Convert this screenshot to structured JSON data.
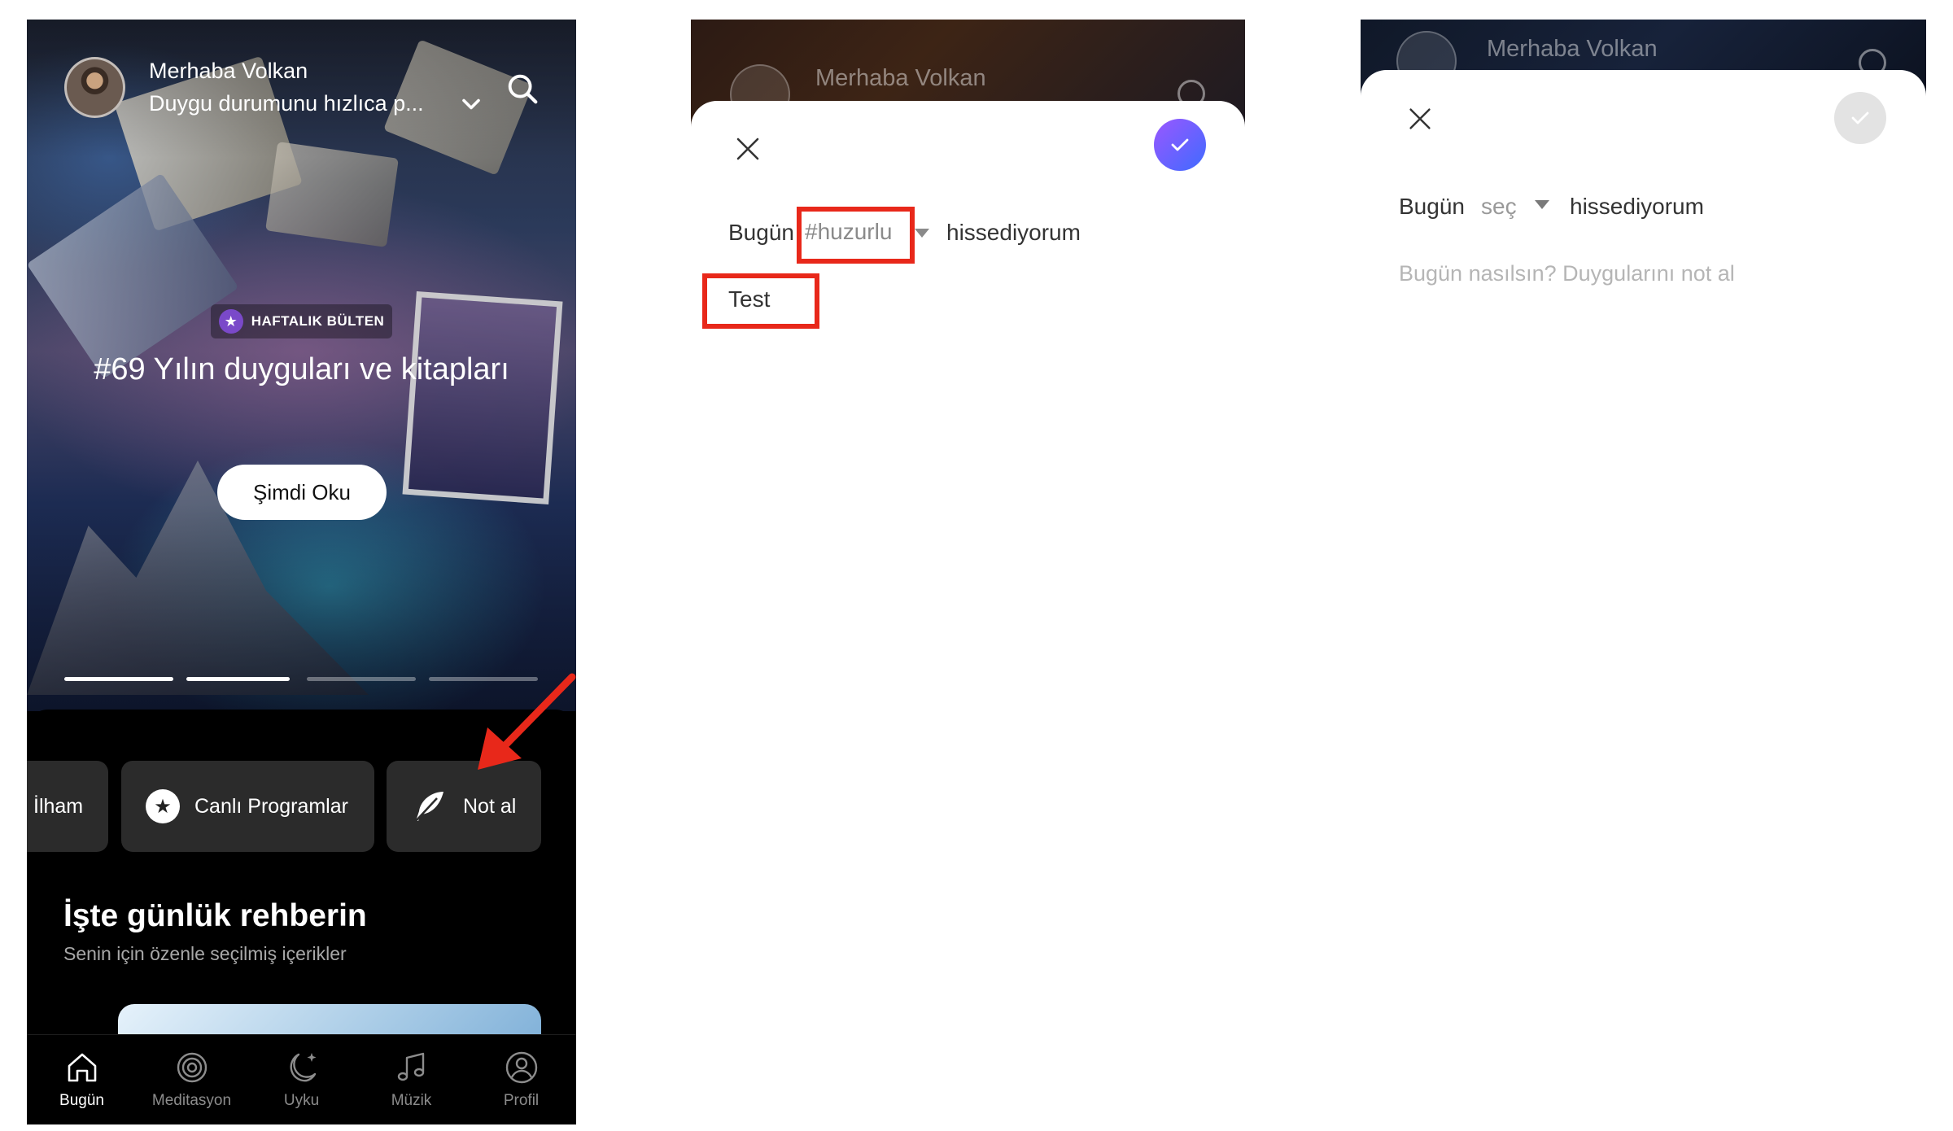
{
  "panel1": {
    "header": {
      "greeting": "Merhaba Volkan",
      "mood_prompt": "Duygu durumunu hızlıca p..."
    },
    "hero": {
      "badge": "HAFTALIK BÜLTEN",
      "title": "#69 Yılın duyguları ve kitapları",
      "cta": "Şimdi Oku",
      "carousel_pages": 4,
      "carousel_active_index": 1
    },
    "chips": [
      {
        "label": "İlham",
        "icon": "partial"
      },
      {
        "label": "Canlı Programlar",
        "icon": "star-badge-icon"
      },
      {
        "label": "Not al",
        "icon": "feather-icon"
      }
    ],
    "guide": {
      "title": "İşte günlük rehberin",
      "subtitle": "Senin için özenle seçilmiş içerikler"
    },
    "tabs": [
      {
        "label": "Bugün",
        "icon": "home-icon",
        "active": true
      },
      {
        "label": "Meditasyon",
        "icon": "target-icon",
        "active": false
      },
      {
        "label": "Uyku",
        "icon": "moon-icon",
        "active": false
      },
      {
        "label": "Müzik",
        "icon": "music-note-icon",
        "active": false
      },
      {
        "label": "Profil",
        "icon": "profile-icon",
        "active": false
      }
    ]
  },
  "panel2": {
    "background_greeting": "Merhaba Volkan",
    "prefix": "Bugün",
    "selected_tag": "#huzurlu",
    "suffix": "hissediyorum",
    "note_value": "Test",
    "confirm_enabled": true
  },
  "panel3": {
    "background_greeting": "Merhaba Volkan",
    "prefix": "Bugün",
    "select_placeholder": "seç",
    "suffix": "hissediyorum",
    "note_placeholder": "Bugün nasılsın? Duygularını not al",
    "confirm_enabled": false
  },
  "colors": {
    "highlight": "#e8281a",
    "accent_start": "#9a57ff",
    "accent_end": "#3f6bff",
    "badge_purple": "#7a49c9"
  }
}
